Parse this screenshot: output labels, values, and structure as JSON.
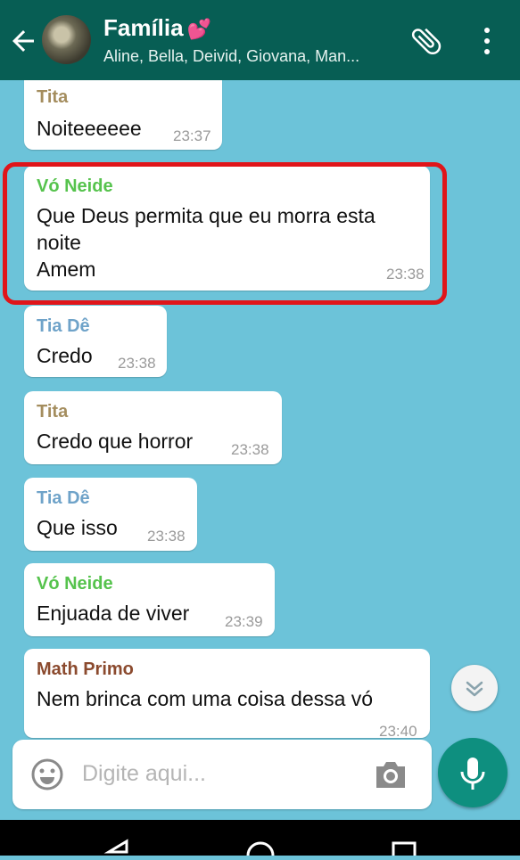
{
  "header": {
    "title": "Família",
    "subtitle": "Aline, Bella, Deivid, Giovana, Man...",
    "title_emoji": "heart-emoji"
  },
  "messages": [
    {
      "sender": "Tita",
      "sender_color": "#a48d5e",
      "lines": [
        "Noiteeeeee"
      ],
      "time": "23:37"
    },
    {
      "sender": "Vó Neide",
      "sender_color": "#56c34d",
      "lines": [
        "Que Deus permita que eu morra esta",
        "noite",
        "Amem"
      ],
      "time": "23:38"
    },
    {
      "sender": "Tia Dê",
      "sender_color": "#6fa3c9",
      "lines": [
        "Credo"
      ],
      "time": "23:38"
    },
    {
      "sender": "Tita",
      "sender_color": "#a48d5e",
      "lines": [
        "Credo que horror"
      ],
      "time": "23:38"
    },
    {
      "sender": "Tia Dê",
      "sender_color": "#6fa3c9",
      "lines": [
        "Que isso"
      ],
      "time": "23:38"
    },
    {
      "sender": "Vó Neide",
      "sender_color": "#56c34d",
      "lines": [
        "Enjuada de viver"
      ],
      "time": "23:39"
    },
    {
      "sender": "Math Primo",
      "sender_color": "#8b4a2e",
      "lines": [
        "Nem brinca com uma coisa dessa vó"
      ],
      "time": "23:40"
    }
  ],
  "input": {
    "placeholder": "Digite aqui..."
  },
  "icons": {
    "back": "arrow-left-icon",
    "attach": "paperclip-icon",
    "menu": "more-vert-icon",
    "emoji": "smiley-icon",
    "camera": "camera-icon",
    "mic": "mic-icon",
    "scroll": "chevron-double-down-icon"
  },
  "colors": {
    "header": "#075e54",
    "chat_bg": "#6cc3d9",
    "highlight": "#e0151a",
    "mic": "#0e8f7f"
  }
}
